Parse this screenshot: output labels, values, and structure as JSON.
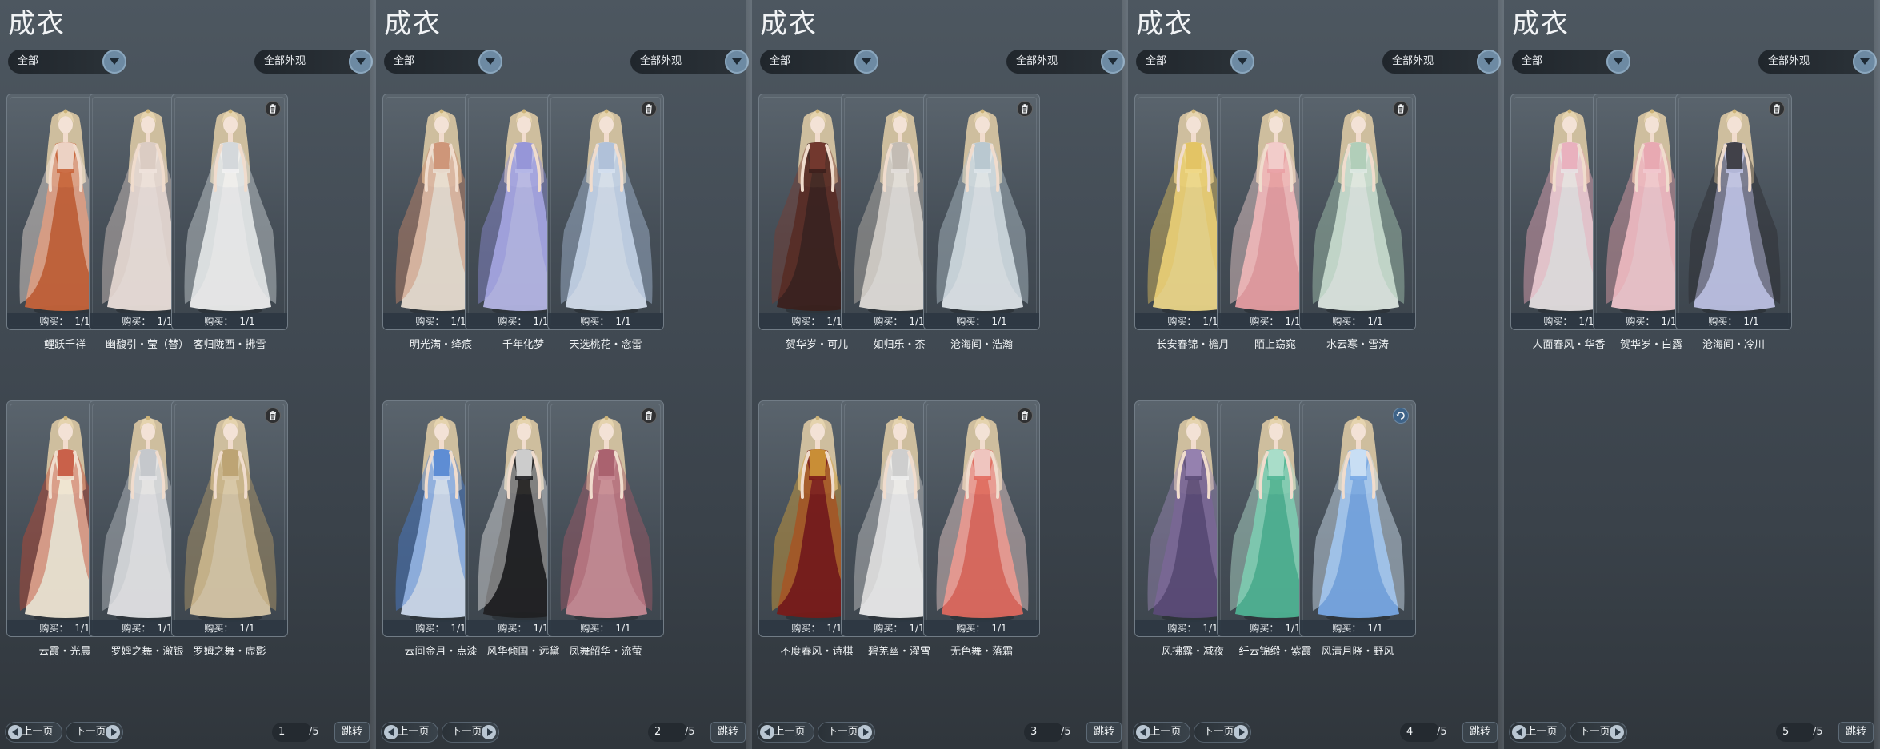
{
  "panels": [
    {
      "title": "成衣",
      "category_filter": "全部",
      "appearance_filter": "全部外观",
      "page_current": "1",
      "page_total": "/5",
      "prev_label": "上一页",
      "next_label": "下一页",
      "jump_label": "跳转",
      "items": [
        {
          "name": "鲤跃千祥",
          "buy_label": "购买：",
          "buy_count": "1/1",
          "corner_icon": "trash-icon",
          "dress": "#c9643a",
          "accent": "#f2e4dc"
        },
        {
          "name": "幽馥引・莹（替）",
          "buy_label": "购买：",
          "buy_count": "1/1",
          "corner_icon": "trash-icon",
          "dress": "#efe3dd",
          "accent": "#d8c8c0"
        },
        {
          "name": "客归陇西・拂雪",
          "buy_label": "购买：",
          "buy_count": "1/1",
          "corner_icon": "trash-icon",
          "dress": "#f2f2f2",
          "accent": "#cfd4d8"
        },
        {
          "name": "云霞・光晨",
          "buy_label": "购买：",
          "buy_count": "1/1",
          "corner_icon": "trash-icon",
          "dress": "#f2e8d6",
          "accent": "#c24a33"
        },
        {
          "name": "罗姆之舞・澈银",
          "buy_label": "购买：",
          "buy_count": "1/1",
          "corner_icon": "trash-icon",
          "dress": "#e6e6e8",
          "accent": "#bfc3c8"
        },
        {
          "name": "罗姆之舞・虚影",
          "buy_label": "购买：",
          "buy_count": "1/1",
          "corner_icon": "trash-icon",
          "dress": "#d9c9a8",
          "accent": "#b99d6b"
        }
      ]
    },
    {
      "title": "成衣",
      "category_filter": "全部",
      "appearance_filter": "全部外观",
      "page_current": "2",
      "page_total": "/5",
      "prev_label": "上一页",
      "next_label": "下一页",
      "jump_label": "跳转",
      "items": [
        {
          "name": "明光满・绛痕",
          "buy_label": "购买：",
          "buy_count": "1/1",
          "corner_icon": "trash-icon",
          "dress": "#eadfd3",
          "accent": "#c98a6a"
        },
        {
          "name": "千年化梦",
          "buy_label": "购买：",
          "buy_count": "1/1",
          "corner_icon": "trash-icon",
          "dress": "#b7b9e8",
          "accent": "#8f8fd6"
        },
        {
          "name": "天选桃花・念雷",
          "buy_label": "购买：",
          "buy_count": "1/1",
          "corner_icon": "trash-icon",
          "dress": "#d6e1ef",
          "accent": "#a9bcd6"
        },
        {
          "name": "云间金月・点漆",
          "buy_label": "购买：",
          "buy_count": "1/1",
          "corner_icon": "trash-icon",
          "dress": "#cfdcef",
          "accent": "#4a7fd0"
        },
        {
          "name": "风华倾国・远黛",
          "buy_label": "购买：",
          "buy_count": "1/1",
          "corner_icon": "trash-icon",
          "dress": "#1f1f22",
          "accent": "#e9e9e9"
        },
        {
          "name": "凤舞韶华・流萤",
          "buy_label": "购买：",
          "buy_count": "1/1",
          "corner_icon": "trash-icon",
          "dress": "#c98c96",
          "accent": "#a45a68"
        }
      ]
    },
    {
      "title": "成衣",
      "category_filter": "全部",
      "appearance_filter": "全部外观",
      "page_current": "3",
      "page_total": "/5",
      "prev_label": "上一页",
      "next_label": "下一页",
      "jump_label": "跳转",
      "items": [
        {
          "name": "贺华岁・可儿",
          "buy_label": "购买：",
          "buy_count": "1/1",
          "corner_icon": "trash-icon",
          "dress": "#3b1f1c",
          "accent": "#7a3b30"
        },
        {
          "name": "如归乐・茶",
          "buy_label": "购买：",
          "buy_count": "1/1",
          "corner_icon": "trash-icon",
          "dress": "#e3dfdb",
          "accent": "#bdb6ae"
        },
        {
          "name": "沧海间・浩瀚",
          "buy_label": "购买：",
          "buy_count": "1/1",
          "corner_icon": "trash-icon",
          "dress": "#dfe6ea",
          "accent": "#b3c3cc"
        },
        {
          "name": "不度春风・诗棋",
          "buy_label": "购买：",
          "buy_count": "1/1",
          "corner_icon": "refresh-icon",
          "dress": "#7a1a18",
          "accent": "#d6a13a"
        },
        {
          "name": "碧羌幽・濯雪",
          "buy_label": "购买：",
          "buy_count": "1/1",
          "corner_icon": "trash-icon",
          "dress": "#eeeeee",
          "accent": "#c9c9c9"
        },
        {
          "name": "无色舞・落霜",
          "buy_label": "购买：",
          "buy_count": "1/1",
          "corner_icon": "trash-icon",
          "dress": "#e26a5e",
          "accent": "#f1d3cf"
        }
      ]
    },
    {
      "title": "成衣",
      "category_filter": "全部",
      "appearance_filter": "全部外观",
      "page_current": "4",
      "page_total": "/5",
      "prev_label": "上一页",
      "next_label": "下一页",
      "jump_label": "跳转",
      "items": [
        {
          "name": "长安春锦・檐月",
          "buy_label": "购买：",
          "buy_count": "1/1",
          "corner_icon": "trash-icon",
          "dress": "#efd98a",
          "accent": "#e2c15e"
        },
        {
          "name": "陌上窈窕",
          "buy_label": "购买：",
          "buy_count": "1/1",
          "corner_icon": "trash-icon",
          "dress": "#e9a0a4",
          "accent": "#f3d3d1"
        },
        {
          "name": "水云寒・雪涛",
          "buy_label": "购买：",
          "buy_count": "1/1",
          "corner_icon": "trash-icon",
          "dress": "#dfe9e3",
          "accent": "#a9c9b3"
        },
        {
          "name": "风拂露・减夜",
          "buy_label": "购买：",
          "buy_count": "1/1",
          "corner_icon": "trash-icon",
          "dress": "#5b4b78",
          "accent": "#9e8ab8"
        },
        {
          "name": "纤云锦缎・紫霞",
          "buy_label": "购买：",
          "buy_count": "1/1",
          "corner_icon": "trash-icon",
          "dress": "#4fb595",
          "accent": "#b7e4d2"
        },
        {
          "name": "风清月晓・野风",
          "buy_label": "购买：",
          "buy_count": "1/1",
          "corner_icon": "refresh-icon",
          "dress": "#78a9e6",
          "accent": "#d5e6f7"
        }
      ]
    },
    {
      "title": "成衣",
      "category_filter": "全部",
      "appearance_filter": "全部外观",
      "page_current": "5",
      "page_total": "/5",
      "prev_label": "上一页",
      "next_label": "下一页",
      "jump_label": "跳转",
      "items": [
        {
          "name": "人面春风・华香",
          "buy_label": "购买：",
          "buy_count": "1/1",
          "corner_icon": "trash-icon",
          "dress": "#e8e3e4",
          "accent": "#e9a8b8"
        },
        {
          "name": "贺华岁・白露",
          "buy_label": "购买：",
          "buy_count": "1/1",
          "corner_icon": "trash-icon",
          "dress": "#f2c9cf",
          "accent": "#e6a3ae"
        },
        {
          "name": "沧海间・冷川",
          "buy_label": "购买：",
          "buy_count": "1/1",
          "corner_icon": "trash-icon",
          "dress": "#bfc3e6",
          "accent": "#2a2a2e"
        }
      ]
    }
  ]
}
